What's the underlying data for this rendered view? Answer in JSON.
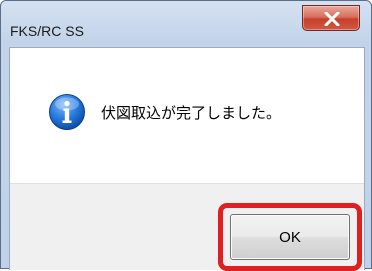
{
  "window": {
    "title": "FKS/RC SS"
  },
  "dialog": {
    "icon": "info-icon",
    "message": "伏図取込が完了しました。",
    "ok_label": "OK"
  },
  "colors": {
    "highlight": "#e02020",
    "close_button": "#c7402b",
    "info_icon": "#1f6fd1"
  }
}
